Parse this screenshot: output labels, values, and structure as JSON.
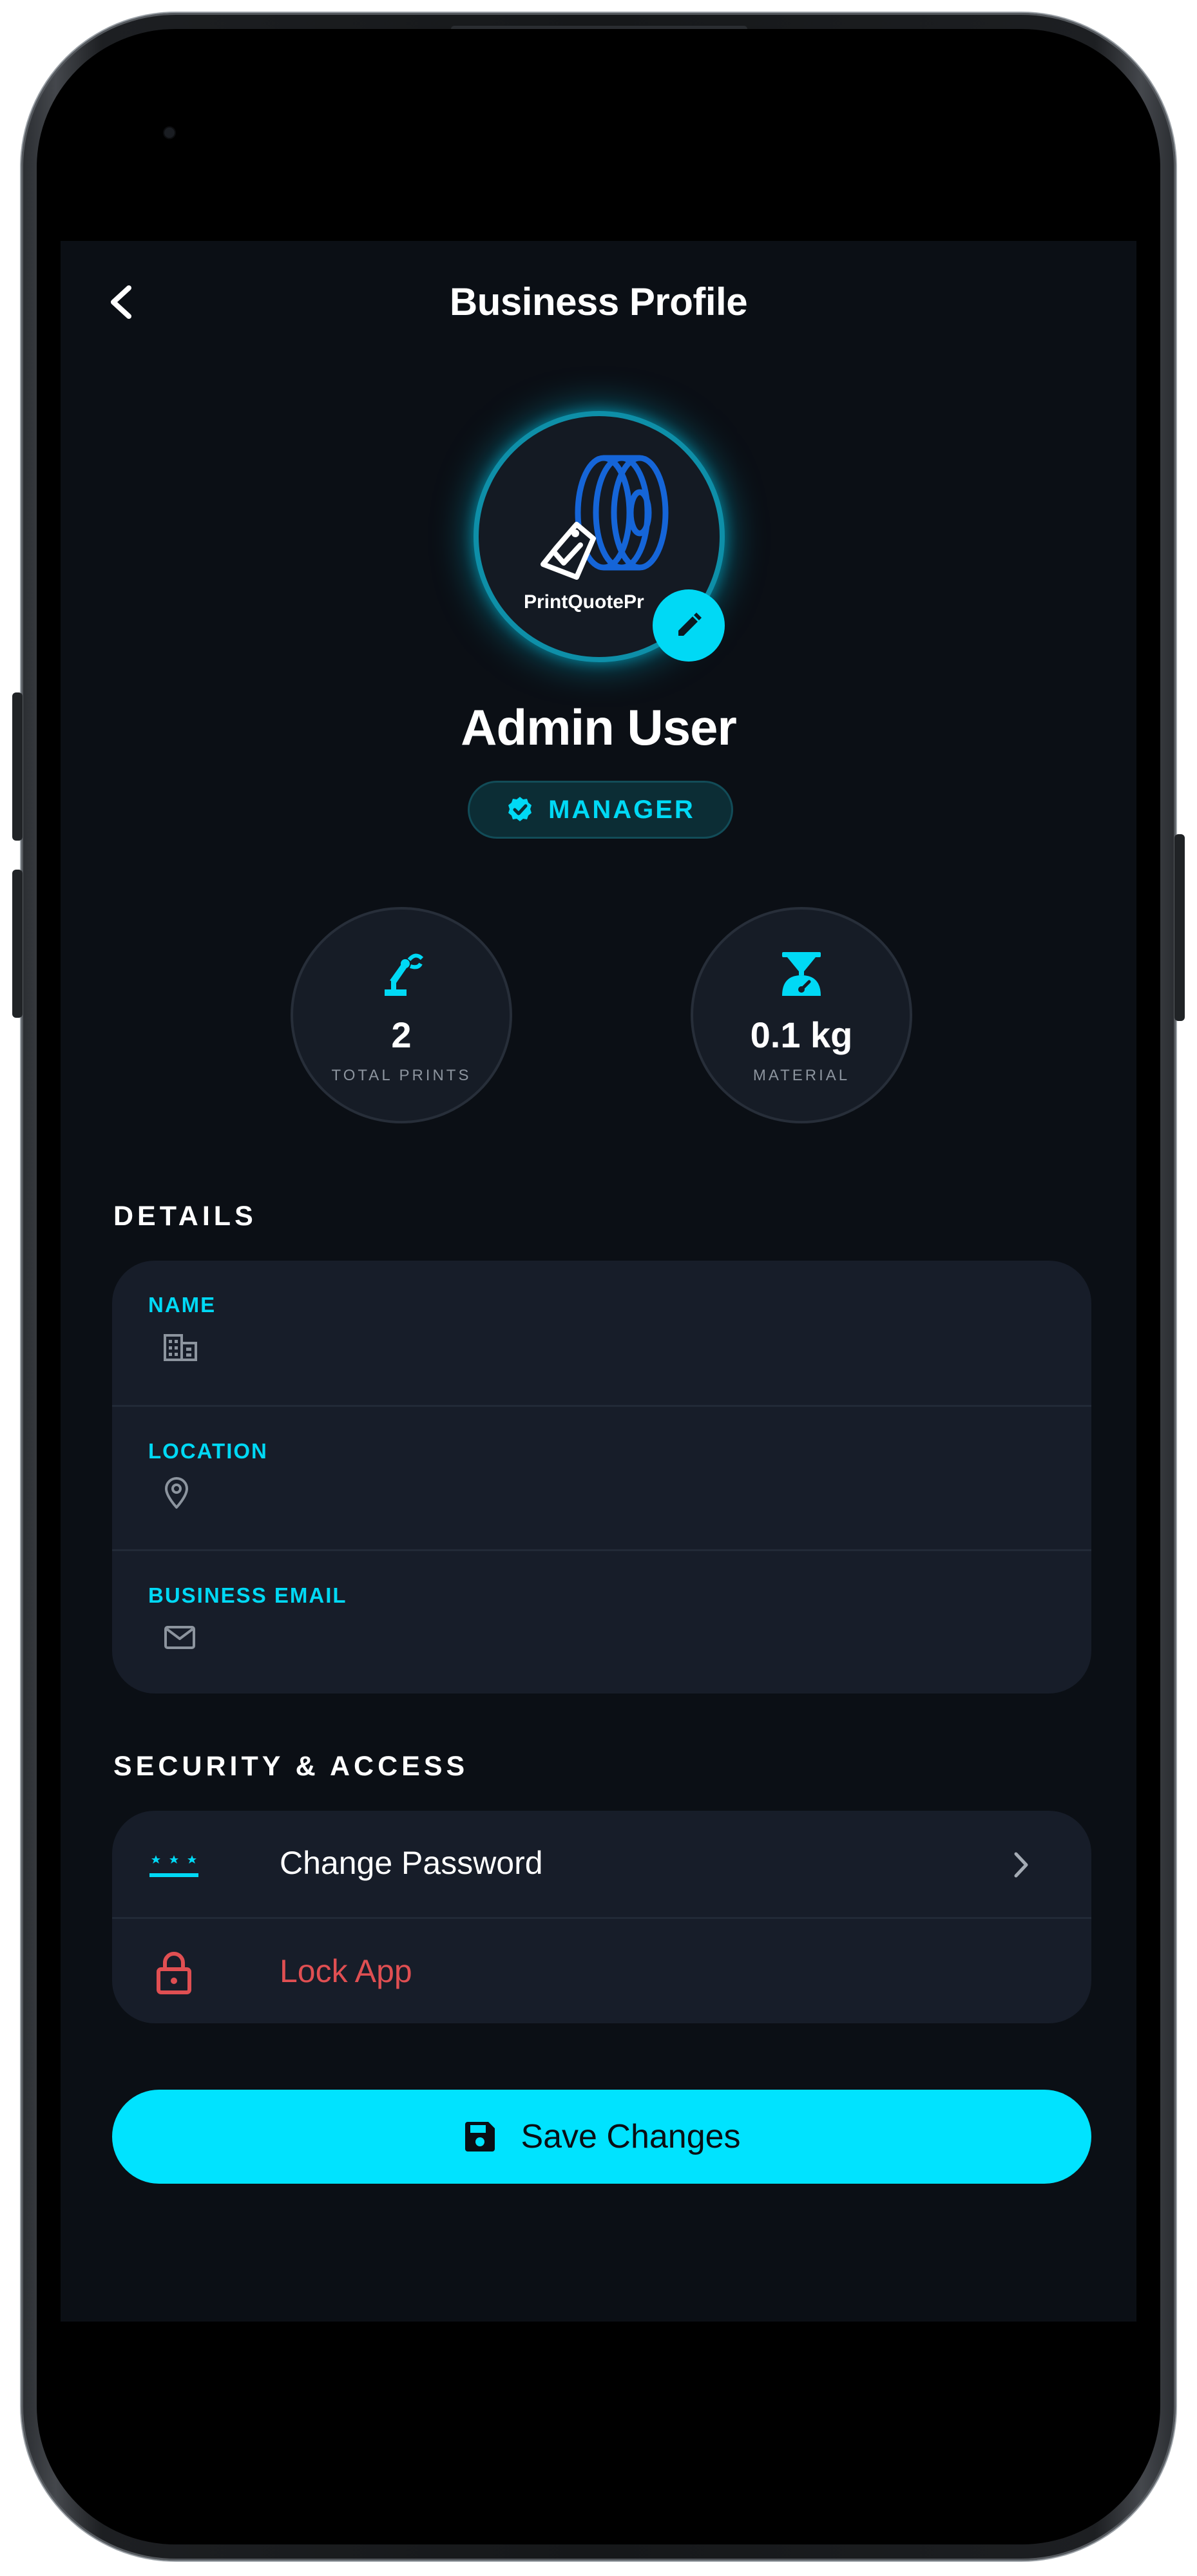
{
  "header": {
    "title": "Business Profile",
    "back_icon": "chevron-left-icon"
  },
  "profile": {
    "avatar_brand": "PrintQuotePr",
    "edit_icon": "pencil-icon",
    "name": "Admin User",
    "role": "MANAGER",
    "role_icon": "verified-check-icon"
  },
  "stats": [
    {
      "icon": "robot-arm-icon",
      "value": "2",
      "label": "TOTAL PRINTS"
    },
    {
      "icon": "scale-icon",
      "value": "0.1 kg",
      "label": "MATERIAL"
    }
  ],
  "details": {
    "section_title": "DETAILS",
    "fields": [
      {
        "label": "NAME",
        "icon": "building-icon",
        "value": ""
      },
      {
        "label": "LOCATION",
        "icon": "location-pin-icon",
        "value": ""
      },
      {
        "label": "BUSINESS EMAIL",
        "icon": "envelope-icon",
        "value": ""
      }
    ]
  },
  "security": {
    "section_title": "SECURITY & ACCESS",
    "items": [
      {
        "label": "Change Password",
        "icon": "password-dots-icon",
        "trailing_icon": "chevron-right-icon"
      },
      {
        "label": "Lock App",
        "icon": "lock-icon"
      }
    ]
  },
  "save_button": {
    "label": "Save Changes",
    "icon": "floppy-disk-icon"
  },
  "colors": {
    "accent": "#00E3FF",
    "background": "#0B0F15",
    "card": "#171D29",
    "danger": "#E04F52",
    "muted": "#8C949E"
  }
}
